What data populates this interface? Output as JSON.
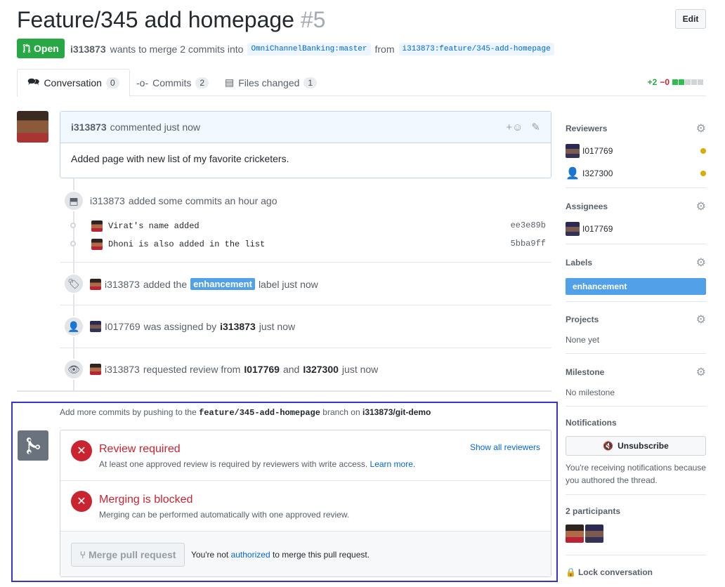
{
  "header": {
    "title": "Feature/345 add homepage",
    "number": "#5",
    "edit_label": "Edit",
    "state": "Open",
    "author": "i313873",
    "merge_text": "wants to merge 2 commits into",
    "base_branch": "OmniChannelBanking:master",
    "from_text": "from",
    "head_branch": "i313873:feature/345-add-homepage"
  },
  "tabs": [
    {
      "label": "Conversation",
      "count": "0"
    },
    {
      "label": "Commits",
      "count": "2"
    },
    {
      "label": "Files changed",
      "count": "1"
    }
  ],
  "diffstat": {
    "additions": "+2",
    "deletions": "−0"
  },
  "comment": {
    "author": "i313873",
    "time": "commented just now",
    "body": "Added page with new list of my favorite cricketers."
  },
  "events": {
    "commits_actor": "i313873",
    "commits_text": "added some commits an hour ago",
    "commits": [
      {
        "message": "Virat's name added",
        "sha": "ee3e89b"
      },
      {
        "message": "Dhoni is also added in the list",
        "sha": "5bba9ff"
      }
    ],
    "label_actor": "i313873",
    "label_pre": "added the",
    "label_name": "enhancement",
    "label_post": "label just now",
    "assign_actor": "I017769",
    "assign_text": "was assigned by",
    "assign_by": "i313873",
    "assign_time": "just now",
    "review_actor": "i313873",
    "review_text": "requested review from",
    "review_user1": "I017769",
    "review_and": "and",
    "review_user2": "I327300",
    "review_time": "just now"
  },
  "merge": {
    "hint_pre": "Add more commits by pushing to the",
    "hint_branch": "feature/345-add-homepage",
    "hint_mid": "branch on",
    "hint_repo": "i313873/git-demo",
    "review_title": "Review required",
    "review_desc": "At least one approved review is required by reviewers with write access.",
    "learn_more": "Learn more.",
    "show_reviewers": "Show all reviewers",
    "blocked_title": "Merging is blocked",
    "blocked_desc": "Merging can be performed automatically with one approved review.",
    "merge_btn": "Merge pull request",
    "note_pre": "You're not",
    "note_link": "authorized",
    "note_post": "to merge this pull request."
  },
  "sidebar": {
    "reviewers_title": "Reviewers",
    "reviewers": [
      "I017769",
      "I327300"
    ],
    "assignees_title": "Assignees",
    "assignee": "I017769",
    "labels_title": "Labels",
    "label": "enhancement",
    "projects_title": "Projects",
    "projects_value": "None yet",
    "milestone_title": "Milestone",
    "milestone_value": "No milestone",
    "notifications_title": "Notifications",
    "unsubscribe": "Unsubscribe",
    "notif_text": "You're receiving notifications because you authored the thread.",
    "participants_title": "2 participants",
    "lock": "Lock conversation"
  },
  "colors": {
    "open_green": "#28a745",
    "error_red": "#cb2431",
    "label_blue": "#52a0e8",
    "highlight_outline": "#3535c8"
  }
}
